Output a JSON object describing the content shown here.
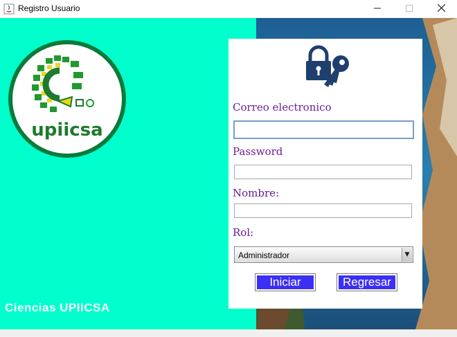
{
  "window": {
    "title": "Registro Usuario"
  },
  "colors": {
    "left_panel": "#00ffcc",
    "label_purple": "#6a1b9a",
    "button_blue": "#3c2ff5",
    "logo_green": "#0a7a3a"
  },
  "logo": {
    "text": "upiicsa"
  },
  "footer": {
    "text": "Ciencias UPIICSA"
  },
  "form": {
    "email_label": "Correo electronico",
    "email_value": "",
    "password_label": "Password",
    "password_value": "",
    "name_label": "Nombre:",
    "name_value": "",
    "role_label": "Rol:",
    "role_selected": "Administrador",
    "login_button": "Iniciar",
    "back_button": "Regresar"
  },
  "icons": [
    "java-app-icon",
    "minimize-icon",
    "maximize-icon",
    "close-icon",
    "lock-key-icon",
    "chevron-down-icon"
  ]
}
